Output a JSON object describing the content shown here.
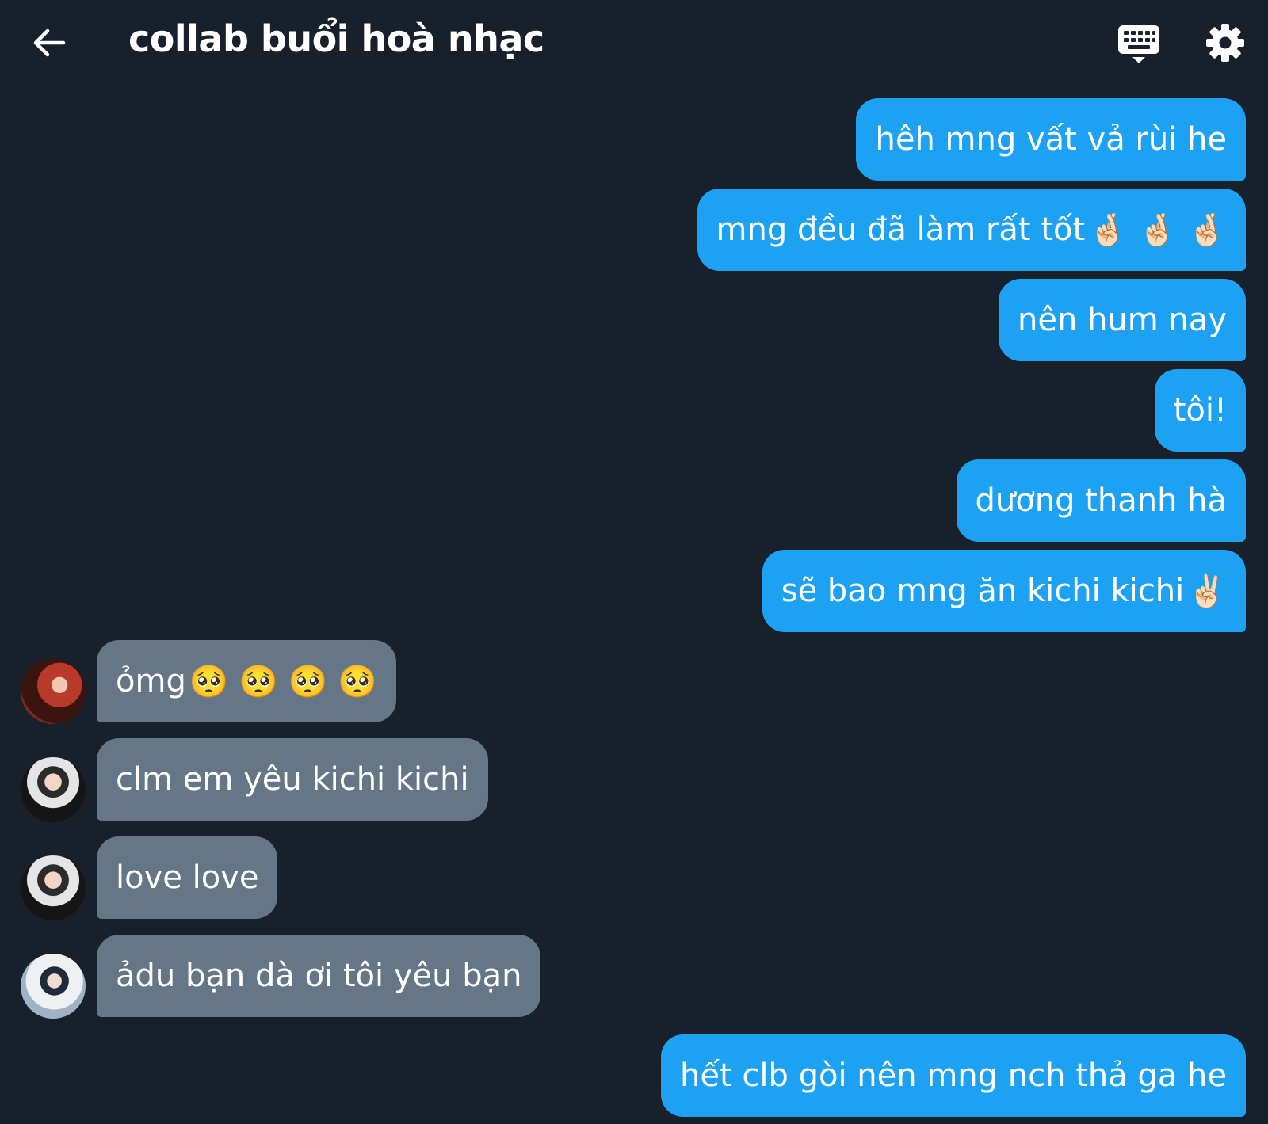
{
  "header": {
    "title": "collab buổi hoà nhạc",
    "back_icon": "arrow-left-icon",
    "keyboard_icon": "keyboard-icon",
    "settings_icon": "gear-icon"
  },
  "colors": {
    "background": "#17202b",
    "outgoing_bubble": "#1da1f2",
    "incoming_bubble": "#657786",
    "text": "#ffffff"
  },
  "messages": [
    {
      "direction": "out",
      "text": "hêh mng vất vả rùi he",
      "emoji": ""
    },
    {
      "direction": "out",
      "text": "mng đều đã làm rất tốt",
      "emoji": "🤞🏻 🤞🏻 🤞🏻"
    },
    {
      "direction": "out",
      "text": "nên hum nay",
      "emoji": ""
    },
    {
      "direction": "out",
      "text": "tôi!",
      "emoji": ""
    },
    {
      "direction": "out",
      "text": "dương thanh hà",
      "emoji": ""
    },
    {
      "direction": "out",
      "text": "sẽ bao mng ăn kichi kichi",
      "emoji": "✌🏻"
    },
    {
      "direction": "in",
      "text": "ỏmg",
      "emoji": "🥺 🥺 🥺 🥺",
      "avatar": "avatar-icon"
    },
    {
      "direction": "in",
      "text": "clm em yêu kichi kichi",
      "emoji": "",
      "avatar": "avatar-icon"
    },
    {
      "direction": "in",
      "text": "love love",
      "emoji": "",
      "avatar": "avatar-icon"
    },
    {
      "direction": "in",
      "text": "ảdu bạn dà ơi tôi yêu bạn",
      "emoji": "",
      "avatar": "avatar-icon"
    },
    {
      "direction": "out",
      "text": "hết clb gòi nên mng nch thả ga he",
      "emoji": ""
    }
  ]
}
